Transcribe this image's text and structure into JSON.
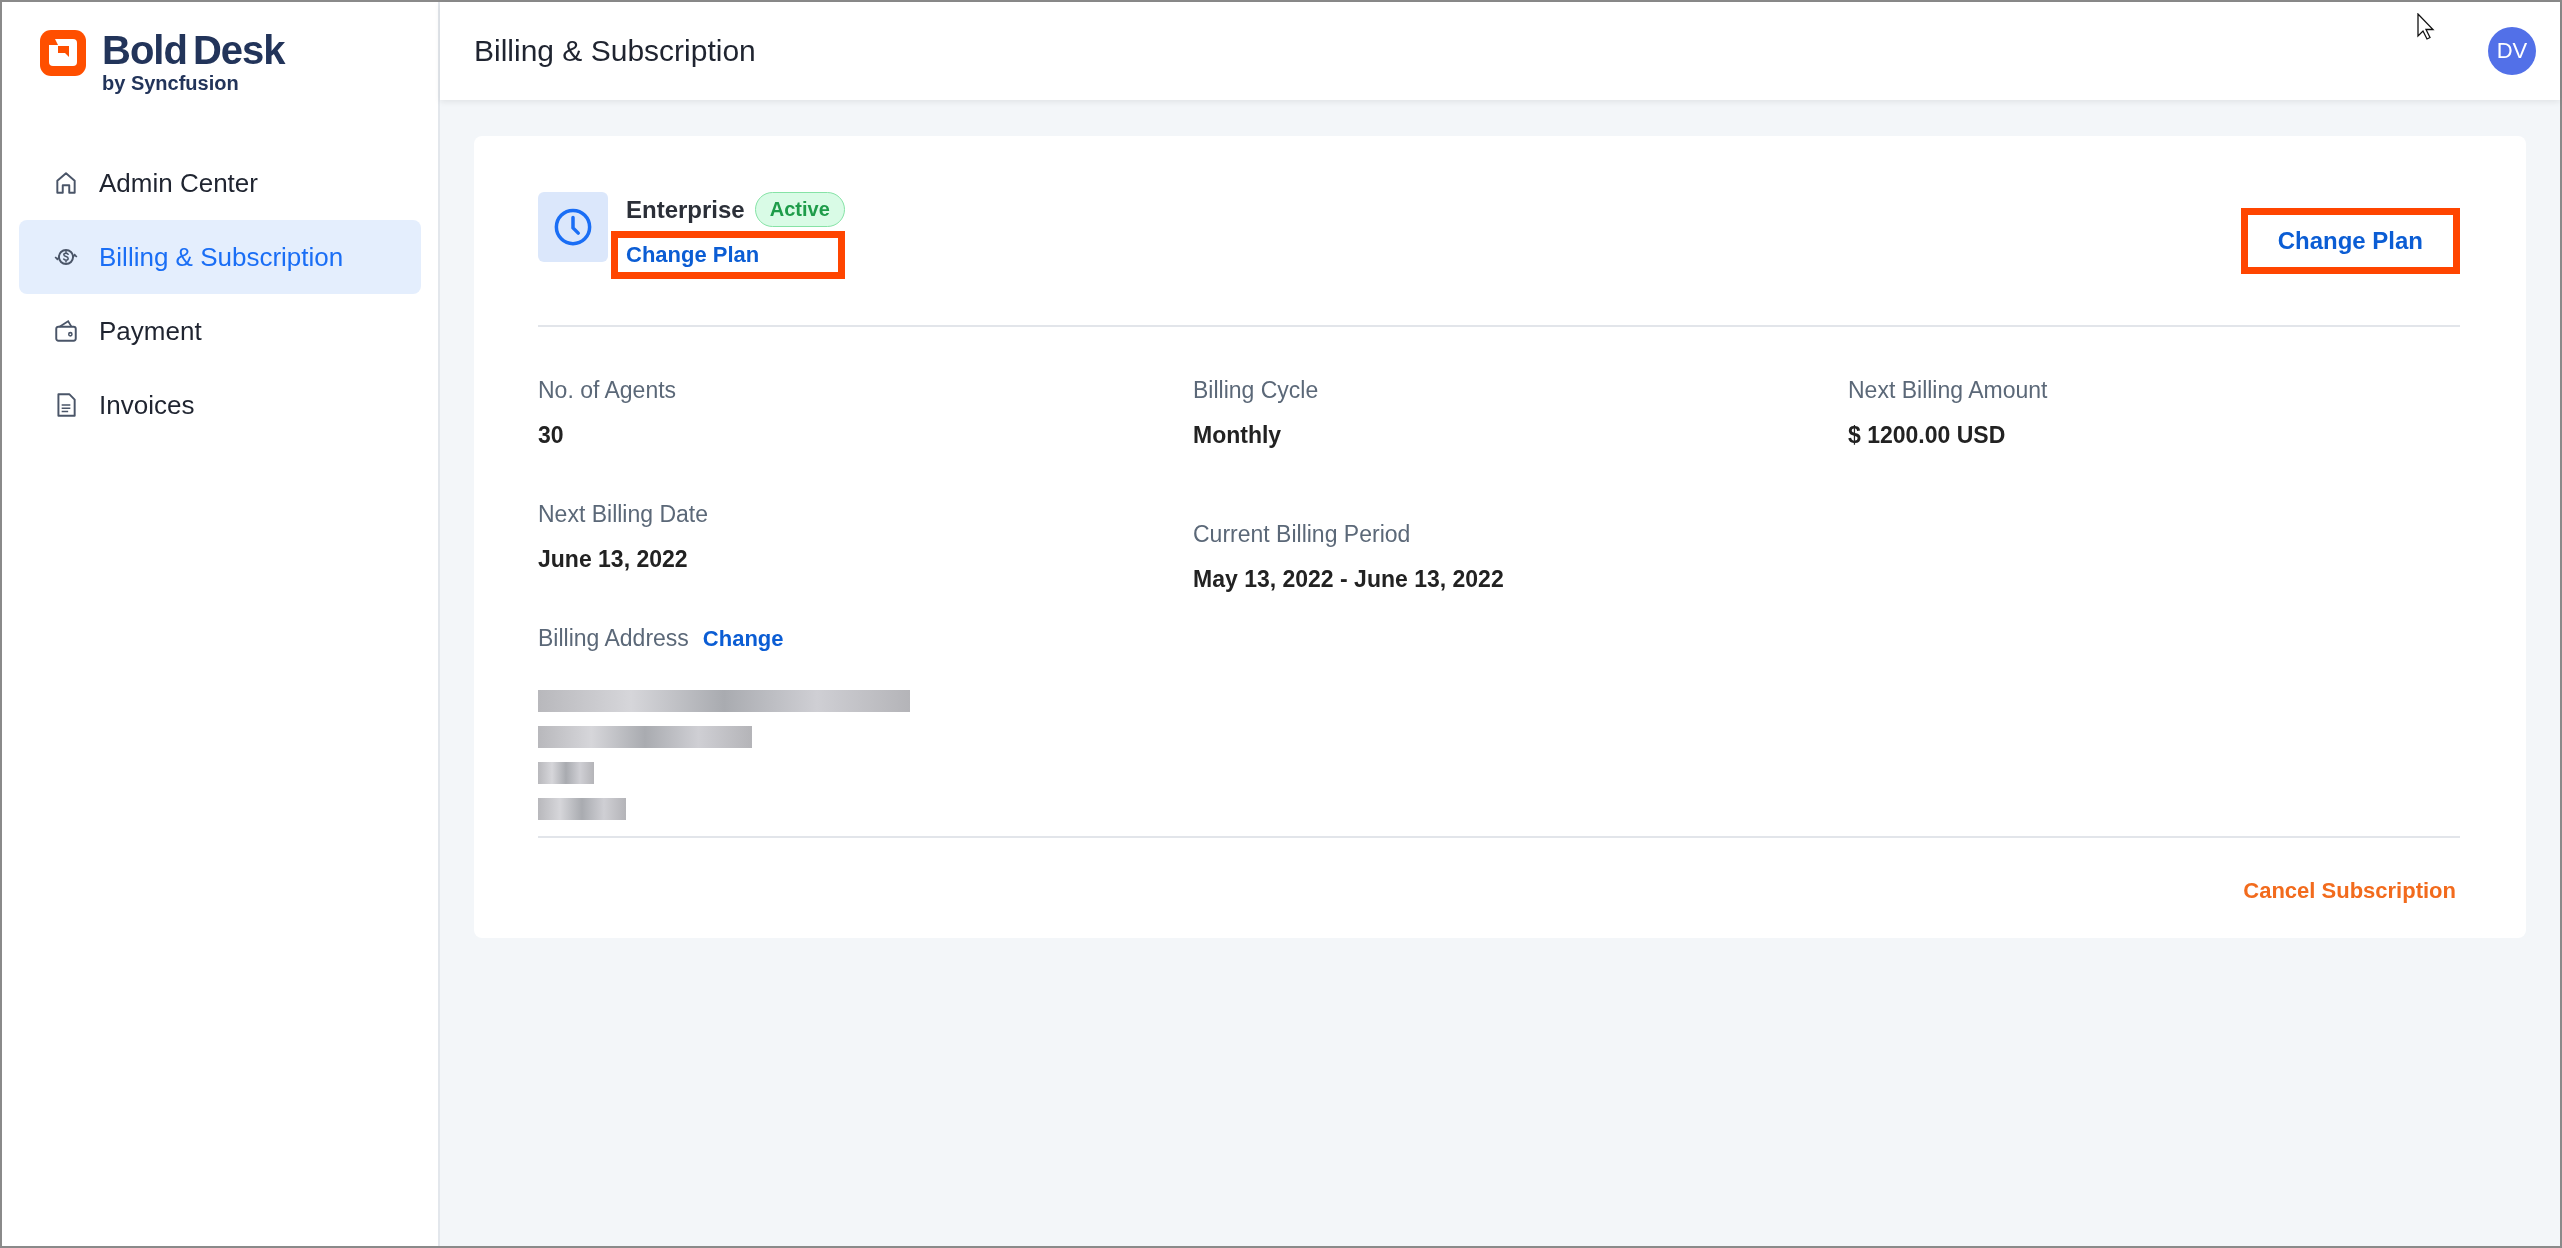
{
  "logo": {
    "word_1": "Bold",
    "word_2": "Desk",
    "tagline": "by Syncfusion"
  },
  "sidebar": {
    "items": [
      {
        "label": "Admin Center",
        "kind": "home",
        "selected": false
      },
      {
        "label": "Billing & Subscription",
        "kind": "billing",
        "selected": true
      },
      {
        "label": "Payment",
        "kind": "wallet",
        "selected": false
      },
      {
        "label": "Invoices",
        "kind": "document",
        "selected": false
      }
    ]
  },
  "header": {
    "title": "Billing & Subscription",
    "avatar": "DV"
  },
  "plan": {
    "name": "Enterprise",
    "status": "Active",
    "change_link": "Change Plan",
    "action": "Change Plan"
  },
  "details": {
    "columns": [
      [
        {
          "label": "No. of Agents",
          "value": "30"
        },
        {
          "label": "Next Billing Date",
          "value": "June 13, 2022"
        }
      ],
      [
        {
          "label": "Billing Cycle",
          "value": "Monthly"
        },
        {
          "label": "Current Billing Period",
          "value": "May 13, 2022 - June 13, 2022"
        }
      ],
      [
        {
          "label": "Next Billing Amount",
          "value": "$ 1200.00 USD"
        }
      ]
    ]
  },
  "address": {
    "label": "Billing Address",
    "change_link": "Change"
  },
  "footer": {
    "cancel": "Cancel Subscription"
  }
}
